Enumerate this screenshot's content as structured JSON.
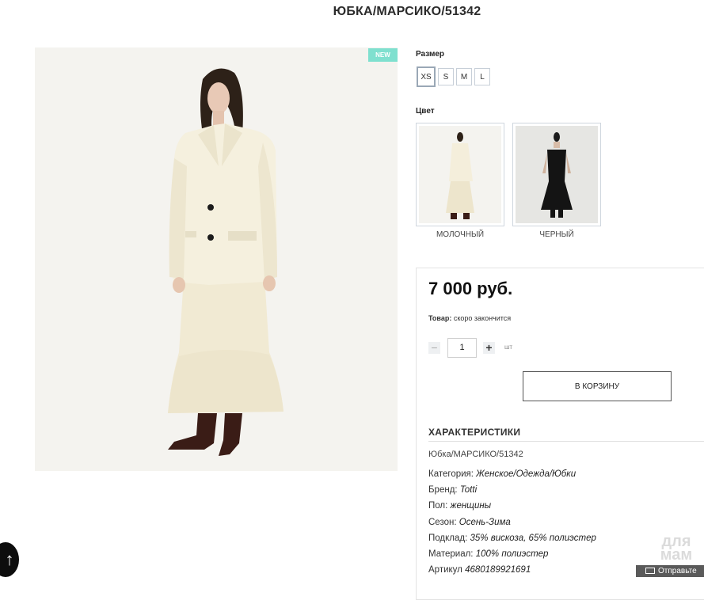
{
  "product": {
    "title": "ЮБКА/МАРСИКО/51342",
    "badge": "NEW"
  },
  "size": {
    "label": "Размер",
    "options": [
      "XS",
      "S",
      "M",
      "L"
    ],
    "selected": "XS"
  },
  "color": {
    "label": "Цвет",
    "options": [
      {
        "name": "МОЛОЧНЫЙ"
      },
      {
        "name": "ЧЕРНЫЙ"
      }
    ]
  },
  "buy": {
    "price": "7 000 руб.",
    "stock_label": "Товар:",
    "stock_value": "скоро закончится",
    "qty_minus": "−",
    "qty_value": "1",
    "qty_plus": "+",
    "qty_unit": "шт",
    "cart_button": "В КОРЗИНУ"
  },
  "specs": {
    "title": "ХАРАКТЕРИСТИКИ",
    "subtitle": "Юбка/МАРСИКО/51342",
    "rows": [
      {
        "key": "Категория:",
        "value": "Женское/Одежда/Юбки"
      },
      {
        "key": "Бренд:",
        "value": "Totti"
      },
      {
        "key": "Пол:",
        "value": "женщины"
      },
      {
        "key": "Сезон:",
        "value": "Осень-Зима"
      },
      {
        "key": "Подклад:",
        "value": "35% вискоза, 65% полиэстер"
      },
      {
        "key": "Материал:",
        "value": "100% полиэстер"
      },
      {
        "key": "Артикул",
        "value": "4680189921691"
      }
    ]
  },
  "overlay": {
    "scroll_icon": "arrow-up-icon",
    "watermark_text": "для мам",
    "watermark_button": "Отправьте"
  },
  "colors": {
    "badge": "#7fe0cf",
    "cream": "#f4efdc",
    "black_dress": "#141414"
  }
}
